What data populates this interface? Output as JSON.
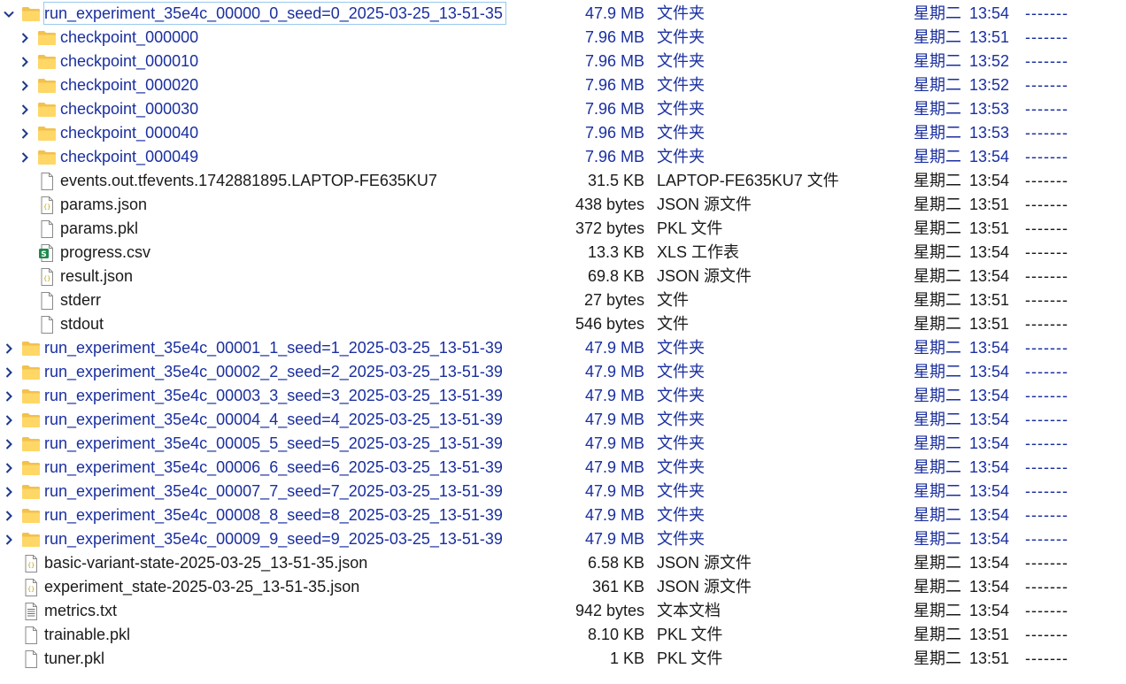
{
  "rows": [
    {
      "name": "run_experiment_35e4c_00000_0_seed=0_2025-03-25_13-51-35",
      "size": "47.9 MB",
      "type": "文件夹",
      "day": "星期二",
      "time": "13:54",
      "attr": "-------",
      "kind": "folder",
      "icon": "folder-icon",
      "expand": "expanded",
      "selected": true,
      "level": 0
    },
    {
      "name": "checkpoint_000000",
      "size": "7.96 MB",
      "type": "文件夹",
      "day": "星期二",
      "time": "13:51",
      "attr": "-------",
      "kind": "folder",
      "icon": "folder-icon",
      "expand": "collapsed",
      "level": 1
    },
    {
      "name": "checkpoint_000010",
      "size": "7.96 MB",
      "type": "文件夹",
      "day": "星期二",
      "time": "13:52",
      "attr": "-------",
      "kind": "folder",
      "icon": "folder-icon",
      "expand": "collapsed",
      "level": 1
    },
    {
      "name": "checkpoint_000020",
      "size": "7.96 MB",
      "type": "文件夹",
      "day": "星期二",
      "time": "13:52",
      "attr": "-------",
      "kind": "folder",
      "icon": "folder-icon",
      "expand": "collapsed",
      "level": 1
    },
    {
      "name": "checkpoint_000030",
      "size": "7.96 MB",
      "type": "文件夹",
      "day": "星期二",
      "time": "13:53",
      "attr": "-------",
      "kind": "folder",
      "icon": "folder-icon",
      "expand": "collapsed",
      "level": 1
    },
    {
      "name": "checkpoint_000040",
      "size": "7.96 MB",
      "type": "文件夹",
      "day": "星期二",
      "time": "13:53",
      "attr": "-------",
      "kind": "folder",
      "icon": "folder-icon",
      "expand": "collapsed",
      "level": 1
    },
    {
      "name": "checkpoint_000049",
      "size": "7.96 MB",
      "type": "文件夹",
      "day": "星期二",
      "time": "13:54",
      "attr": "-------",
      "kind": "folder",
      "icon": "folder-icon",
      "expand": "collapsed",
      "level": 1
    },
    {
      "name": "events.out.tfevents.1742881895.LAPTOP-FE635KU7",
      "size": "31.5 KB",
      "type": "LAPTOP-FE635KU7 文件",
      "day": "星期二",
      "time": "13:54",
      "attr": "-------",
      "kind": "file",
      "icon": "blank-file-icon",
      "level": 1
    },
    {
      "name": "params.json",
      "size": "438 bytes",
      "type": "JSON 源文件",
      "day": "星期二",
      "time": "13:51",
      "attr": "-------",
      "kind": "file",
      "icon": "json-file-icon",
      "level": 1
    },
    {
      "name": "params.pkl",
      "size": "372 bytes",
      "type": "PKL 文件",
      "day": "星期二",
      "time": "13:51",
      "attr": "-------",
      "kind": "file",
      "icon": "blank-file-icon",
      "level": 1
    },
    {
      "name": "progress.csv",
      "size": "13.3 KB",
      "type": "XLS 工作表",
      "day": "星期二",
      "time": "13:54",
      "attr": "-------",
      "kind": "file",
      "icon": "spreadsheet-file-icon",
      "level": 1
    },
    {
      "name": "result.json",
      "size": "69.8 KB",
      "type": "JSON 源文件",
      "day": "星期二",
      "time": "13:54",
      "attr": "-------",
      "kind": "file",
      "icon": "json-file-icon",
      "level": 1
    },
    {
      "name": "stderr",
      "size": "27 bytes",
      "type": "文件",
      "day": "星期二",
      "time": "13:51",
      "attr": "-------",
      "kind": "file",
      "icon": "blank-file-icon",
      "level": 1
    },
    {
      "name": "stdout",
      "size": "546 bytes",
      "type": "文件",
      "day": "星期二",
      "time": "13:51",
      "attr": "-------",
      "kind": "file",
      "icon": "blank-file-icon",
      "level": 1
    },
    {
      "name": "run_experiment_35e4c_00001_1_seed=1_2025-03-25_13-51-39",
      "size": "47.9 MB",
      "type": "文件夹",
      "day": "星期二",
      "time": "13:54",
      "attr": "-------",
      "kind": "folder",
      "icon": "folder-icon",
      "expand": "collapsed",
      "level": 0
    },
    {
      "name": "run_experiment_35e4c_00002_2_seed=2_2025-03-25_13-51-39",
      "size": "47.9 MB",
      "type": "文件夹",
      "day": "星期二",
      "time": "13:54",
      "attr": "-------",
      "kind": "folder",
      "icon": "folder-icon",
      "expand": "collapsed",
      "level": 0
    },
    {
      "name": "run_experiment_35e4c_00003_3_seed=3_2025-03-25_13-51-39",
      "size": "47.9 MB",
      "type": "文件夹",
      "day": "星期二",
      "time": "13:54",
      "attr": "-------",
      "kind": "folder",
      "icon": "folder-icon",
      "expand": "collapsed",
      "level": 0
    },
    {
      "name": "run_experiment_35e4c_00004_4_seed=4_2025-03-25_13-51-39",
      "size": "47.9 MB",
      "type": "文件夹",
      "day": "星期二",
      "time": "13:54",
      "attr": "-------",
      "kind": "folder",
      "icon": "folder-icon",
      "expand": "collapsed",
      "level": 0
    },
    {
      "name": "run_experiment_35e4c_00005_5_seed=5_2025-03-25_13-51-39",
      "size": "47.9 MB",
      "type": "文件夹",
      "day": "星期二",
      "time": "13:54",
      "attr": "-------",
      "kind": "folder",
      "icon": "folder-icon",
      "expand": "collapsed",
      "level": 0
    },
    {
      "name": "run_experiment_35e4c_00006_6_seed=6_2025-03-25_13-51-39",
      "size": "47.9 MB",
      "type": "文件夹",
      "day": "星期二",
      "time": "13:54",
      "attr": "-------",
      "kind": "folder",
      "icon": "folder-icon",
      "expand": "collapsed",
      "level": 0
    },
    {
      "name": "run_experiment_35e4c_00007_7_seed=7_2025-03-25_13-51-39",
      "size": "47.9 MB",
      "type": "文件夹",
      "day": "星期二",
      "time": "13:54",
      "attr": "-------",
      "kind": "folder",
      "icon": "folder-icon",
      "expand": "collapsed",
      "level": 0
    },
    {
      "name": "run_experiment_35e4c_00008_8_seed=8_2025-03-25_13-51-39",
      "size": "47.9 MB",
      "type": "文件夹",
      "day": "星期二",
      "time": "13:54",
      "attr": "-------",
      "kind": "folder",
      "icon": "folder-icon",
      "expand": "collapsed",
      "level": 0
    },
    {
      "name": "run_experiment_35e4c_00009_9_seed=9_2025-03-25_13-51-39",
      "size": "47.9 MB",
      "type": "文件夹",
      "day": "星期二",
      "time": "13:54",
      "attr": "-------",
      "kind": "folder",
      "icon": "folder-icon",
      "expand": "collapsed",
      "level": 0
    },
    {
      "name": "basic-variant-state-2025-03-25_13-51-35.json",
      "size": "6.58 KB",
      "type": "JSON 源文件",
      "day": "星期二",
      "time": "13:54",
      "attr": "-------",
      "kind": "file",
      "icon": "json-file-icon",
      "level": 0
    },
    {
      "name": "experiment_state-2025-03-25_13-51-35.json",
      "size": "361 KB",
      "type": "JSON 源文件",
      "day": "星期二",
      "time": "13:54",
      "attr": "-------",
      "kind": "file",
      "icon": "json-file-icon",
      "level": 0
    },
    {
      "name": "metrics.txt",
      "size": "942 bytes",
      "type": "文本文档",
      "day": "星期二",
      "time": "13:54",
      "attr": "-------",
      "kind": "file",
      "icon": "text-file-icon",
      "level": 0
    },
    {
      "name": "trainable.pkl",
      "size": "8.10 KB",
      "type": "PKL 文件",
      "day": "星期二",
      "time": "13:51",
      "attr": "-------",
      "kind": "file",
      "icon": "blank-file-icon",
      "level": 0
    },
    {
      "name": "tuner.pkl",
      "size": "1 KB",
      "type": "PKL 文件",
      "day": "星期二",
      "time": "13:51",
      "attr": "-------",
      "kind": "file",
      "icon": "blank-file-icon",
      "level": 0
    }
  ]
}
